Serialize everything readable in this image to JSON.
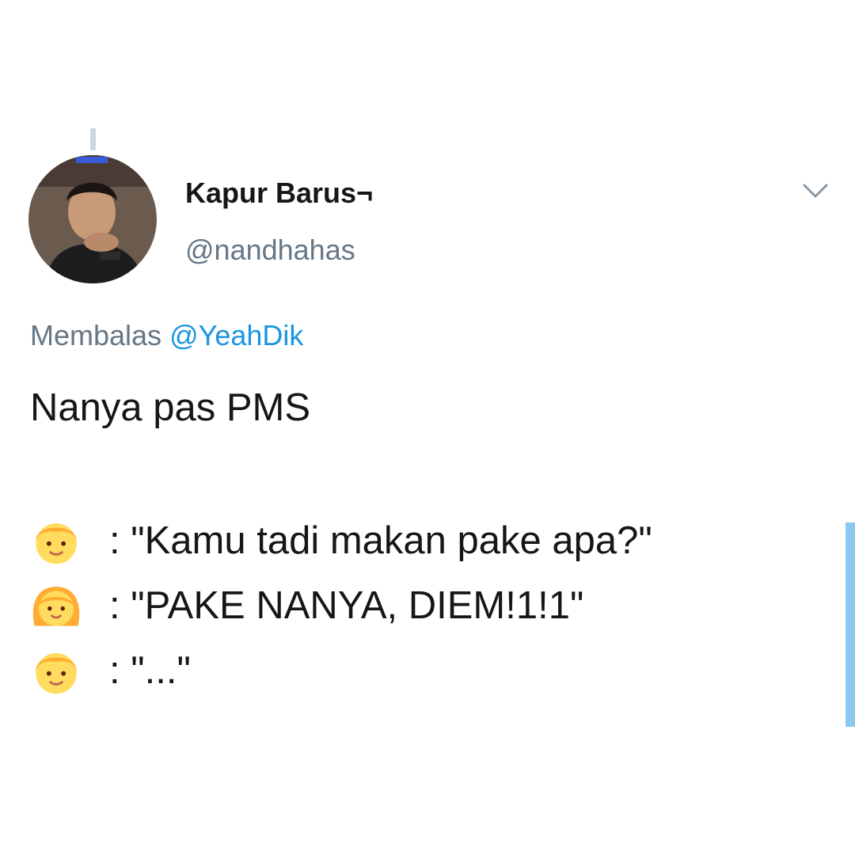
{
  "tweet": {
    "author": {
      "display_name": "Kapur Barus¬",
      "handle": "@nandhahas",
      "avatar_icon": "profile-photo"
    },
    "menu_icon": "chevron-down-icon",
    "reply": {
      "prefix": "Membalas",
      "mention": "@YeahDik"
    },
    "text_first_line": "Nanya pas PMS",
    "dialog": [
      {
        "emoji": "boy-emoji",
        "text": ": \"Kamu tadi makan pake apa?\""
      },
      {
        "emoji": "girl-emoji",
        "text": ": \"PAKE NANYA, DIEM!1!1\""
      },
      {
        "emoji": "boy-emoji",
        "text": ": \"...\""
      }
    ]
  },
  "colors": {
    "text": "#14171a",
    "secondary": "#657786",
    "link": "#1b95e0",
    "thread_line": "#ccd6dd",
    "emoji_skin": "#ffdc5d",
    "emoji_hair": "#ffac33",
    "scroll_indicator": "#8cc8ef"
  }
}
